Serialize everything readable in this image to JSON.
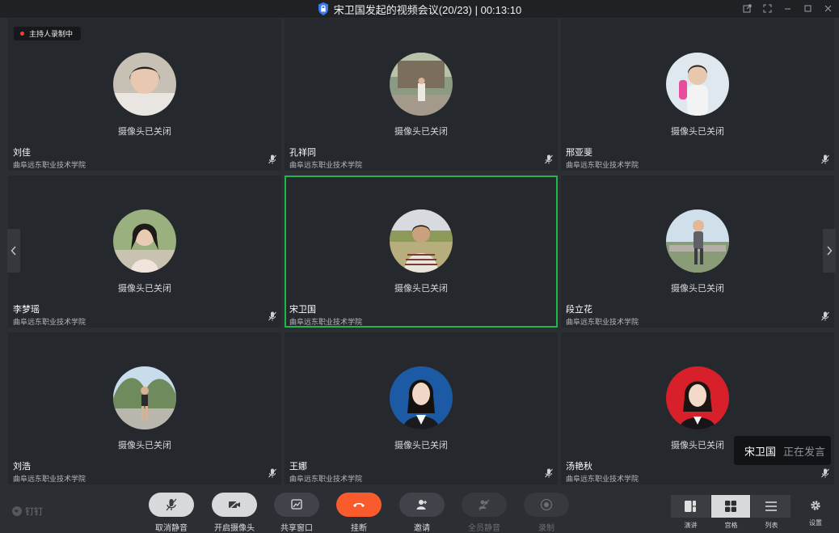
{
  "window": {
    "title": "宋卫国发起的视频会议(20/23) | 00:13:10",
    "controls": [
      "restore-icon",
      "fullscreen-icon",
      "minimize-icon",
      "maximize-icon",
      "close-icon"
    ]
  },
  "recording_badge": "主持人录制中",
  "camera_off_text": "摄像头已关闭",
  "organization": "曲阜远东职业技术学院",
  "participants": [
    {
      "name": "刘佳",
      "active": false,
      "mic": "muted"
    },
    {
      "name": "孔祥同",
      "active": false,
      "mic": "muted"
    },
    {
      "name": "邢亚斐",
      "active": false,
      "mic": "muted"
    },
    {
      "name": "李梦瑶",
      "active": false,
      "mic": "muted"
    },
    {
      "name": "宋卫国",
      "active": true,
      "mic": "on"
    },
    {
      "name": "段立花",
      "active": false,
      "mic": "muted"
    },
    {
      "name": "刘浩",
      "active": false,
      "mic": "muted"
    },
    {
      "name": "王娜",
      "active": false,
      "mic": "muted"
    },
    {
      "name": "汤艳秋",
      "active": false,
      "mic": "muted"
    }
  ],
  "speaking": {
    "name": "宋卫国",
    "status": "正在发言"
  },
  "brand": "钉钉",
  "toolbar": {
    "unmute": "取消静音",
    "camera_on": "开启摄像头",
    "share": "共享窗口",
    "hangup": "挂断",
    "invite": "邀请",
    "mute_all": "全员静音",
    "record": "录制"
  },
  "views": {
    "speaker": "演讲",
    "gallery": "宫格",
    "list": "列表",
    "selected": "gallery"
  },
  "settings": "设置",
  "colors": {
    "active_border": "#1fb64a",
    "hangup": "#fa5b2c",
    "rec_dot": "#ff3b30"
  }
}
